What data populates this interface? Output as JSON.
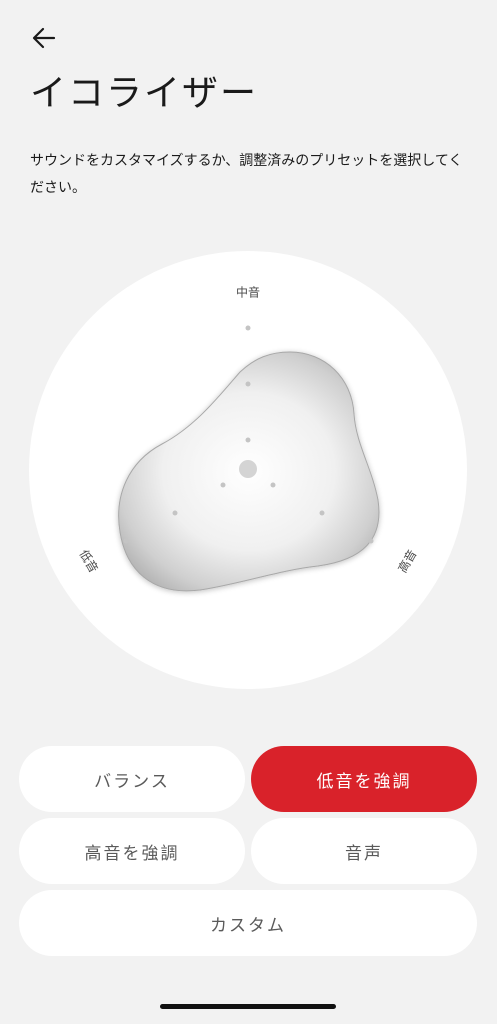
{
  "header": {
    "back_icon": "arrow-left-icon",
    "title": "イコライザー"
  },
  "description": "サウンドをカスタマイズするか、調整済みのプリセットを選択してください。",
  "equalizer": {
    "axes": {
      "mid": "中音",
      "bass": "低音",
      "treble": "高音"
    }
  },
  "presets": [
    {
      "label": "バランス",
      "selected": false
    },
    {
      "label": "低音を強調",
      "selected": true
    },
    {
      "label": "高音を強調",
      "selected": false
    },
    {
      "label": "音声",
      "selected": false
    },
    {
      "label": "カスタム",
      "selected": false
    }
  ],
  "colors": {
    "accent": "#d9222a",
    "background": "#f2f2f2",
    "card": "#ffffff"
  }
}
